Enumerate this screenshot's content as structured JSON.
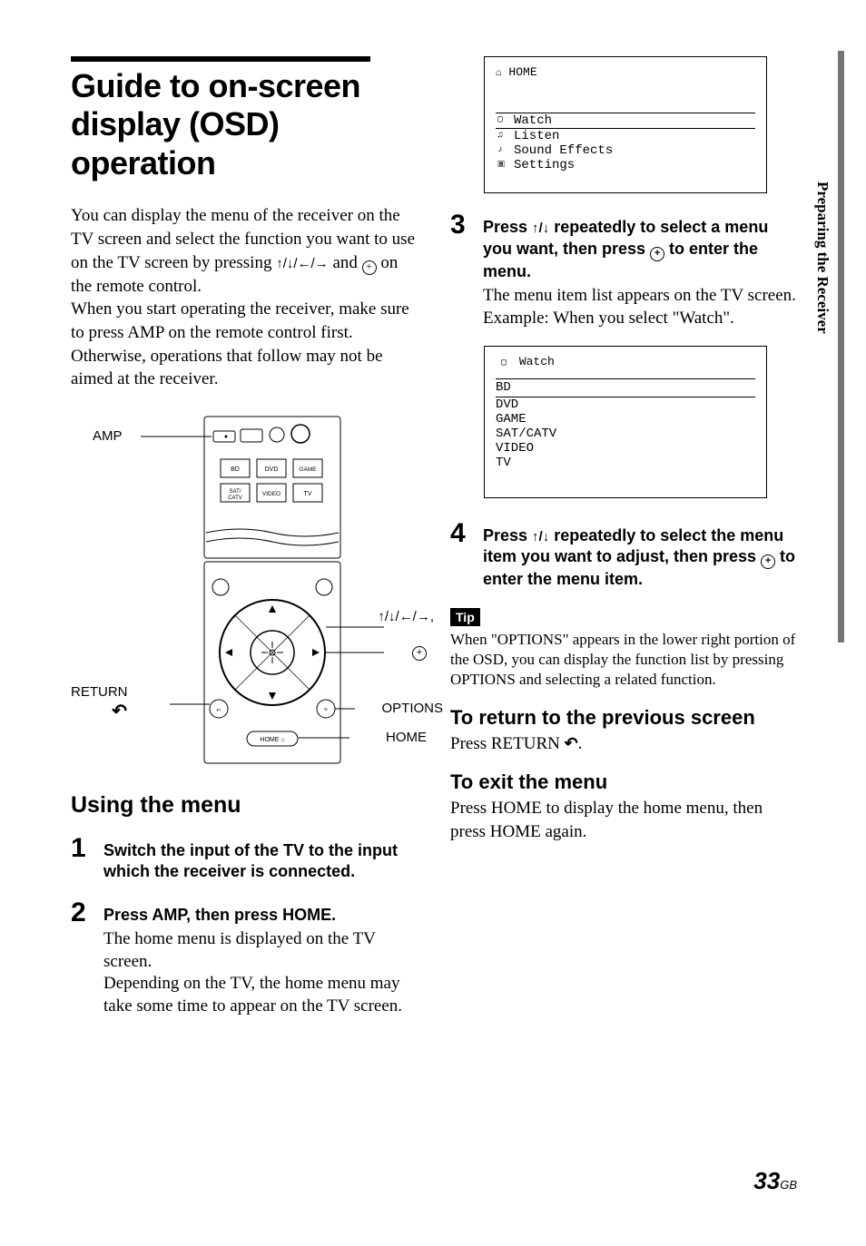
{
  "title": "Guide to on-screen display (OSD) operation",
  "intro_p1": "You can display the menu of the receiver on the TV screen and select the function you want to use on the TV screen by pressing ",
  "intro_arrows": "↑/↓/←/→",
  "intro_mid": " and ",
  "intro_end": " on the remote control.",
  "intro_p2": "When you start operating the receiver, make sure to press AMP on the remote control first. Otherwise, operations that follow may not be aimed at the receiver.",
  "remote": {
    "amp": "AMP",
    "return": "RETURN",
    "options_arrows": "↑/↓/←/→,",
    "options": "OPTIONS",
    "home": "HOME",
    "buttons": {
      "bd": "BD",
      "dvd": "DVD",
      "game": "GAME",
      "sat": "SAT/\nCATV",
      "video": "VIDEO",
      "tv": "TV",
      "home_btn": "HOME"
    }
  },
  "using_menu": "Using the menu",
  "steps": [
    {
      "n": "1",
      "head": "Switch the input of the TV to the input which the receiver is connected."
    },
    {
      "n": "2",
      "head": "Press AMP, then press HOME.",
      "body": "The home menu is displayed on the TV screen.\nDepending on the TV, the home menu may take some time to appear on the TV screen."
    },
    {
      "n": "3",
      "head_a": "Press ",
      "head_arrows": "↑/↓",
      "head_b": " repeatedly to select a menu you want, then press ",
      "head_c": " to enter the menu.",
      "body": "The menu item list appears on the TV screen.\nExample: When you select \"Watch\"."
    },
    {
      "n": "4",
      "head_a": "Press ",
      "head_arrows": "↑/↓",
      "head_b": " repeatedly to select the menu item you want to adjust, then press ",
      "head_c": " to enter the menu item."
    }
  ],
  "osd1": {
    "title": "HOME",
    "home_icon": "⌂",
    "items": [
      {
        "icon": "⃞",
        "label": "Watch",
        "selected": true
      },
      {
        "icon": "🎵",
        "label": "Listen"
      },
      {
        "icon": "♪",
        "label": "Sound Effects"
      },
      {
        "icon": "🔧",
        "label": "Settings"
      }
    ]
  },
  "osd2": {
    "title": "Watch",
    "icon": "⃞",
    "selected": "BD",
    "items": [
      "DVD",
      "GAME",
      "SAT/CATV",
      "VIDEO",
      "TV"
    ]
  },
  "tip_label": "Tip",
  "tip_text": "When \"OPTIONS\" appears in the lower right portion of the OSD, you can display the function list by pressing OPTIONS and selecting a related function.",
  "return_head": "To return to the previous screen",
  "return_body": "Press RETURN ",
  "return_body_end": ".",
  "exit_head": "To exit the menu",
  "exit_body": "Press HOME to display the home menu, then press HOME again.",
  "side_tab": "Preparing the Receiver",
  "page_number": "33",
  "page_suffix": "GB"
}
